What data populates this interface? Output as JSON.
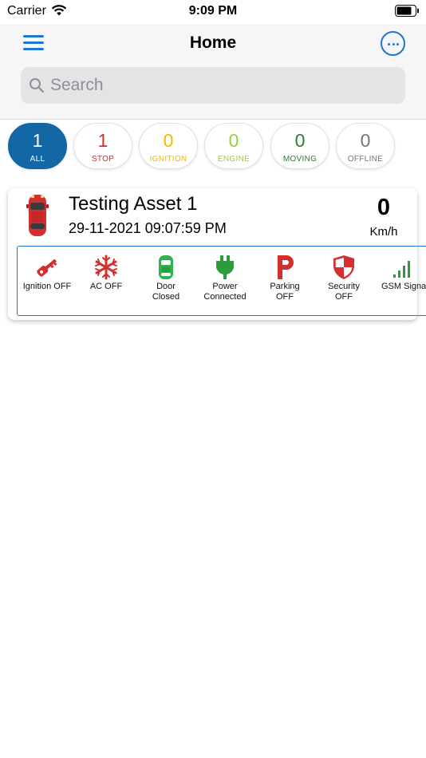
{
  "status_bar": {
    "carrier": "Carrier",
    "time": "9:09 PM"
  },
  "header": {
    "title": "Home"
  },
  "search": {
    "placeholder": "Search",
    "value": ""
  },
  "filters": [
    {
      "count": "1",
      "label": "ALL",
      "color": "#ffffff",
      "active": true
    },
    {
      "count": "1",
      "label": "STOP",
      "color": "#d32f2f"
    },
    {
      "count": "0",
      "label": "IGNITION",
      "color": "#f5b800"
    },
    {
      "count": "0",
      "label": "ENGINE",
      "color": "#9ccc3c"
    },
    {
      "count": "0",
      "label": "MOVING",
      "color": "#2e7d32"
    },
    {
      "count": "0",
      "label": "OFFLINE",
      "color": "#757575"
    }
  ],
  "asset": {
    "name": "Testing Asset 1",
    "datetime": "29-11-2021 09:07:59 PM",
    "speed": "0",
    "speed_unit": "Km/h",
    "car_color": "#d32f2f",
    "status_tiles": [
      {
        "icon": "ignition-key-icon",
        "line1": "Ignition OFF",
        "line2": "",
        "color": "#d32f2f"
      },
      {
        "icon": "ac-snowflake-icon",
        "line1": "AC OFF",
        "line2": "",
        "color": "#d32f2f"
      },
      {
        "icon": "car-door-icon",
        "line1": "Door",
        "line2": "Closed",
        "color": "#2fb34a"
      },
      {
        "icon": "power-plug-icon",
        "line1": "Power",
        "line2": "Connected",
        "color": "#2e9b3a"
      },
      {
        "icon": "parking-icon",
        "line1": "Parking",
        "line2": "OFF",
        "color": "#d32f2f"
      },
      {
        "icon": "security-shield-icon",
        "line1": "Security",
        "line2": "OFF",
        "color": "#d32f2f"
      },
      {
        "icon": "gsm-signal-icon",
        "line1": "GSM Signal",
        "line2": "",
        "color": "#2e9b3a"
      }
    ]
  }
}
